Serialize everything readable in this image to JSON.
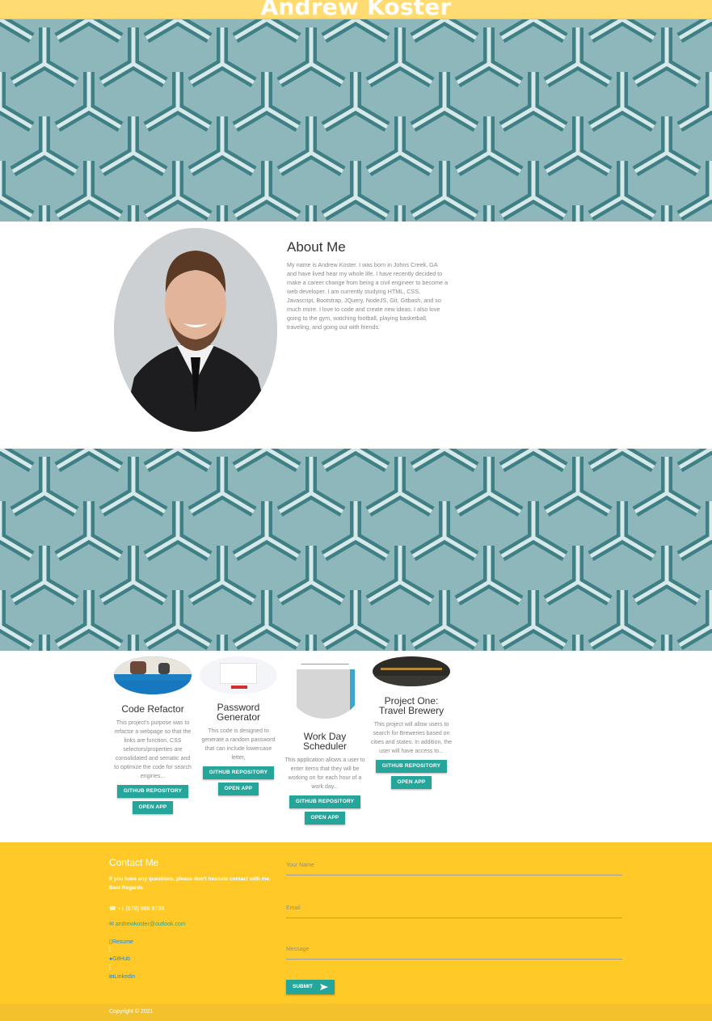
{
  "header": {
    "name": "Andrew Koster"
  },
  "about": {
    "title": "About Me",
    "text": "My name is Andrew Koster. I was born in Johns Creek, GA and have lived hear my whole life. I have recently decided to make a career change from being a civil engineer to become a web developer. I am currently studying HTML, CSS, Javascript, Bootstrap, JQuery, NodeJS, Git, Gitbash, and so much more. I love to code and create new ideas. I also love going to the gym, watching football, playing basketball, traveling, and going out with friends."
  },
  "projects": [
    {
      "title": "Code Refactor",
      "description": "This project's purpose was to refactor a webpage so that the links are function, CSS selectors/properties are consolidated and sematic and to optimize the code for search engines...",
      "repo_label": "Github Repository",
      "app_label": "Open App"
    },
    {
      "title": "Password Generator",
      "description": "This code is designed to generate a random password that can include lowercase letter,",
      "repo_label": "Github Repository",
      "app_label": "Open App"
    },
    {
      "title": "Work Day Scheduler",
      "description": "This application allows a user to enter items that they will be working on for each hour of a work day...",
      "repo_label": "Github Repository",
      "app_label": "Open App"
    },
    {
      "title": "Project One: Travel Brewery",
      "description": "This project will allow users to search for Breweries based on cities and states. In addition, the user will have access to...",
      "repo_label": "Github Repository",
      "app_label": "Open App"
    }
  ],
  "contact": {
    "title": "Contact Me",
    "subtitle": "If you have any questions, please don't hesitate contact with me. Best Regards",
    "phone": "+1 (678) 986 9739",
    "email": "andrewkoster@outlook.com",
    "links": {
      "resume": "Resume",
      "github": "GitHub",
      "linkedin": "LinkedIn",
      "separator": "|"
    },
    "form": {
      "name_placeholder": "Your Name",
      "email_placeholder": "Email",
      "message_placeholder": "Message",
      "submit_label": "SUBMIT"
    }
  },
  "footer": {
    "copyright": "Copyright © 2021"
  },
  "colors": {
    "header": "#ffdb72",
    "contact": "#ffca28",
    "accent": "#26a69a",
    "banner": "#8bb5b8"
  }
}
